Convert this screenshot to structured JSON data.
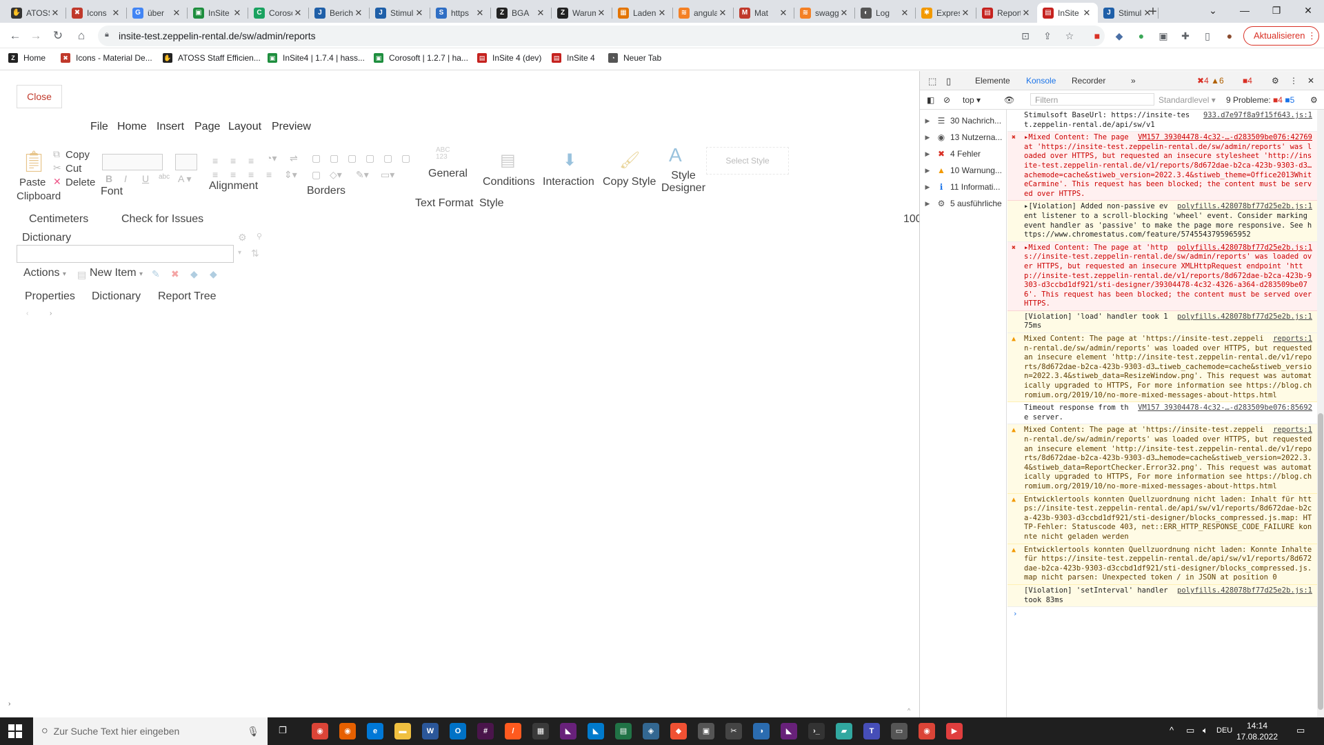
{
  "tabs": [
    {
      "title": "ATOSS",
      "color": "#333",
      "glyph": "✋"
    },
    {
      "title": "Icons",
      "color": "#c0392b",
      "glyph": "✖"
    },
    {
      "title": "über",
      "color": "#4285f4",
      "glyph": "G"
    },
    {
      "title": "InSite",
      "color": "#1e8e3e",
      "glyph": "▣"
    },
    {
      "title": "Corosoft",
      "color": "#1aa260",
      "glyph": "C"
    },
    {
      "title": "Bericht",
      "color": "#1f5fa8",
      "glyph": "J"
    },
    {
      "title": "Stimulsoft",
      "color": "#1f5fa8",
      "glyph": "J"
    },
    {
      "title": "https",
      "color": "#2f6ec4",
      "glyph": "S"
    },
    {
      "title": "BGA",
      "color": "#222",
      "glyph": "Z"
    },
    {
      "title": "Warum",
      "color": "#222",
      "glyph": "Z"
    },
    {
      "title": "Laden",
      "color": "#e37400",
      "glyph": "▦"
    },
    {
      "title": "angular",
      "color": "#f48024",
      "glyph": "≋"
    },
    {
      "title": "Mat",
      "color": "#c0392b",
      "glyph": "M"
    },
    {
      "title": "swagger",
      "color": "#f48024",
      "glyph": "≋"
    },
    {
      "title": "Log",
      "color": "#555",
      "glyph": "◐"
    },
    {
      "title": "Expression",
      "color": "#f29900",
      "glyph": "✱"
    },
    {
      "title": "Report",
      "color": "#c5221f",
      "glyph": "▤"
    },
    {
      "title": "InSite",
      "color": "#c5221f",
      "glyph": "▤"
    },
    {
      "title": "Stimulsoft",
      "color": "#1f5fa8",
      "glyph": "J"
    }
  ],
  "address": {
    "url": "insite-test.zeppelin-rental.de/sw/admin/reports",
    "update_label": "Aktualisieren"
  },
  "bookmarks": [
    {
      "label": "Home",
      "color": "#222",
      "glyph": "Z"
    },
    {
      "label": "Icons - Material De...",
      "color": "#c0392b",
      "glyph": "✖"
    },
    {
      "label": "ATOSS Staff Efficien...",
      "color": "#222",
      "glyph": "✋"
    },
    {
      "label": "InSite4 | 1.7.4 | hass...",
      "color": "#1e8e3e",
      "glyph": "▣"
    },
    {
      "label": "Corosoft | 1.2.7 | ha...",
      "color": "#1e8e3e",
      "glyph": "▣"
    },
    {
      "label": "InSite 4 (dev)",
      "color": "#c5221f",
      "glyph": "▤"
    },
    {
      "label": "InSite 4",
      "color": "#c5221f",
      "glyph": "▤"
    },
    {
      "label": "Neuer Tab",
      "color": "#555",
      "glyph": "◔"
    }
  ],
  "designer": {
    "close_label": "Close",
    "menu": [
      "File",
      "Home",
      "Insert",
      "Page",
      "Layout",
      "Preview"
    ],
    "clipboard": {
      "paste": "Paste",
      "group": "Clipboard",
      "copy": "Copy",
      "cut": "Cut",
      "delete": "Delete"
    },
    "font_group": "Font",
    "alignment_group": "Alignment",
    "borders_group": "Borders",
    "text_format": {
      "general": "General",
      "group": "Text Format"
    },
    "conditions": "Conditions",
    "interaction": "Interaction",
    "copy_style": "Copy Style",
    "style_designer": "Style Designer",
    "select_style": "Select Style",
    "style_group": "Style",
    "units": "Centimeters",
    "check": "Check for Issues",
    "zoom_partial": "100",
    "dictionary_title": "Dictionary",
    "actions_label": "Actions",
    "new_item_label": "New Item",
    "panel_tabs": [
      "Properties",
      "Dictionary",
      "Report Tree"
    ]
  },
  "devtools": {
    "tabs": [
      "Elemente",
      "Konsole",
      "Recorder"
    ],
    "errors": "4",
    "warnings": "6",
    "issues_badge": "4",
    "context": "top",
    "filter_placeholder": "Filtern",
    "level": "Standardlevel",
    "problems": "9 Probleme:",
    "prob_err": "4",
    "prob_info": "5",
    "sidebar": [
      {
        "label": "30 Nachrich...",
        "icon": "☰",
        "color": "#555"
      },
      {
        "label": "13 Nutzerna...",
        "icon": "◉",
        "color": "#555"
      },
      {
        "label": "4 Fehler",
        "icon": "✖",
        "color": "#d93025"
      },
      {
        "label": "10 Warnung...",
        "icon": "▲",
        "color": "#f29900"
      },
      {
        "label": "11 Informati...",
        "icon": "ℹ",
        "color": "#1a73e8"
      },
      {
        "label": "5 ausführliche",
        "icon": "⚙",
        "color": "#555"
      }
    ],
    "messages": [
      {
        "type": "info",
        "src": "933.d7e97f8a9f15f643.js:1",
        "text": "Stimulsoft BaseUrl: https://insite-test.zeppelin-rental.de/api/sw/v1"
      },
      {
        "type": "error",
        "src": "VM157 39304478-4c32-…-d283509be076:42769",
        "text": "▸Mixed Content: The page at 'https://insite-test.zeppelin-rental.de/sw/admin/reports' was loaded over HTTPS, but requested an insecure stylesheet 'http://insite-test.zeppelin-rental.de/v1/reports/8d672dae-b2ca-423b-9303-d3…achemode=cache&stiweb_version=2022.3.4&stiweb_theme=Office2013WhiteCarmine'. This request has been blocked; the content must be served over HTTPS."
      },
      {
        "type": "violation",
        "src": "polyfills.428078bf77d25e2b.js:1",
        "text": "▸[Violation] Added non-passive event listener to a scroll-blocking 'wheel' event. Consider marking event handler as 'passive' to make the page more responsive. See https://www.chromestatus.com/feature/5745543795965952"
      },
      {
        "type": "error",
        "src": "polyfills.428078bf77d25e2b.js:1",
        "text": "▸Mixed Content: The page at 'https://insite-test.zeppelin-rental.de/sw/admin/reports' was loaded over HTTPS, but requested an insecure XMLHttpRequest endpoint 'http://insite-test.zeppelin-rental.de/v1/reports/8d672dae-b2ca-423b-9303-d3ccbd1df921/sti-designer/39304478-4c32-4326-a364-d283509be076'. This request has been blocked; the content must be served over HTTPS."
      },
      {
        "type": "violation",
        "src": "polyfills.428078bf77d25e2b.js:1",
        "text": "[Violation] 'load' handler took 175ms"
      },
      {
        "type": "warn",
        "src": "reports:1",
        "text": "Mixed Content: The page at 'https://insite-test.zeppelin-rental.de/sw/admin/reports' was loaded over HTTPS, but requested an insecure element 'http://insite-test.zeppelin-rental.de/v1/reports/8d672dae-b2ca-423b-9303-d3…tiweb_cachemode=cache&stiweb_version=2022.3.4&stiweb_data=ResizeWindow.png'. This request was automatically upgraded to HTTPS, For more information see https://blog.chromium.org/2019/10/no-more-mixed-messages-about-https.html"
      },
      {
        "type": "info",
        "src": "VM157 39304478-4c32-…-d283509be076:85692",
        "text": "Timeout response from the server."
      },
      {
        "type": "warn",
        "src": "reports:1",
        "text": "Mixed Content: The page at 'https://insite-test.zeppelin-rental.de/sw/admin/reports' was loaded over HTTPS, but requested an insecure element 'http://insite-test.zeppelin-rental.de/v1/reports/8d672dae-b2ca-423b-9303-d3…hemode=cache&stiweb_version=2022.3.4&stiweb_data=ReportChecker.Error32.png'. This request was automatically upgraded to HTTPS, For more information see https://blog.chromium.org/2019/10/no-more-mixed-messages-about-https.html"
      },
      {
        "type": "warn",
        "src": "",
        "text": "Entwicklertools konnten Quellzuordnung nicht laden: Inhalt für https://insite-test.zeppelin-rental.de/api/sw/v1/reports/8d672dae-b2ca-423b-9303-d3ccbd1df921/sti-designer/blocks_compressed.js.map: HTTP-Fehler: Statuscode 403, net::ERR_HTTP_RESPONSE_CODE_FAILURE konnte nicht geladen werden"
      },
      {
        "type": "warn",
        "src": "",
        "text": "Entwicklertools konnten Quellzuordnung nicht laden: Konnte Inhalte für https://insite-test.zeppelin-rental.de/api/sw/v1/reports/8d672dae-b2ca-423b-9303-d3ccbd1df921/sti-designer/blocks_compressed.js.map nicht parsen: Unexpected token / in JSON at position 0"
      },
      {
        "type": "violation",
        "src": "polyfills.428078bf77d25e2b.js:1",
        "text": "[Violation] 'setInterval' handler took 83ms"
      }
    ]
  },
  "taskbar": {
    "search_placeholder": "Zur Suche Text hier eingeben",
    "lang": "DEU",
    "time": "14:14",
    "date": "17.08.2022",
    "apps": [
      {
        "color": "#db4437",
        "glyph": "◉"
      },
      {
        "color": "#e66000",
        "glyph": "◉"
      },
      {
        "color": "#0078d7",
        "glyph": "e"
      },
      {
        "color": "#f0c040",
        "glyph": "▬"
      },
      {
        "color": "#2b579a",
        "glyph": "W"
      },
      {
        "color": "#0072c6",
        "glyph": "O"
      },
      {
        "color": "#4a154b",
        "glyph": "#"
      },
      {
        "color": "#ff5a1f",
        "glyph": "/"
      },
      {
        "color": "#3a3a3a",
        "glyph": "▦"
      },
      {
        "color": "#68217a",
        "glyph": "◣"
      },
      {
        "color": "#007acc",
        "glyph": "◣"
      },
      {
        "color": "#217346",
        "glyph": "▤"
      },
      {
        "color": "#336791",
        "glyph": "◈"
      },
      {
        "color": "#f05133",
        "glyph": "◆"
      },
      {
        "color": "#555",
        "glyph": "▣"
      },
      {
        "color": "#444",
        "glyph": "✂"
      },
      {
        "color": "#2b6cb0",
        "glyph": "◑"
      },
      {
        "color": "#68217a",
        "glyph": "◣"
      },
      {
        "color": "#333",
        "glyph": "›_"
      },
      {
        "color": "#31a8a0",
        "glyph": "▰"
      },
      {
        "color": "#464eb8",
        "glyph": "T"
      },
      {
        "color": "#555",
        "glyph": "▭"
      },
      {
        "color": "#db4437",
        "glyph": "◉"
      },
      {
        "color": "#e03e3e",
        "glyph": "▶"
      }
    ]
  }
}
